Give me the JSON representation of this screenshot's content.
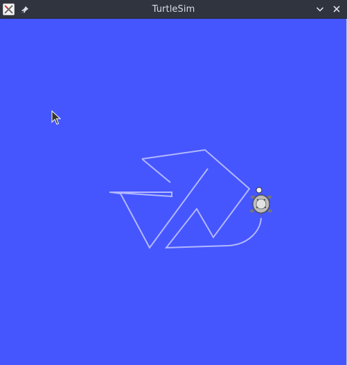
{
  "window": {
    "title": "TurtleSim",
    "background_color": "#4556ff",
    "pen_color": "#b3b8ff",
    "icons": {
      "app": "turtlesim-app-icon",
      "pin": "pin-icon",
      "minimize": "chevron-down-icon",
      "close": "close-icon"
    }
  }
}
